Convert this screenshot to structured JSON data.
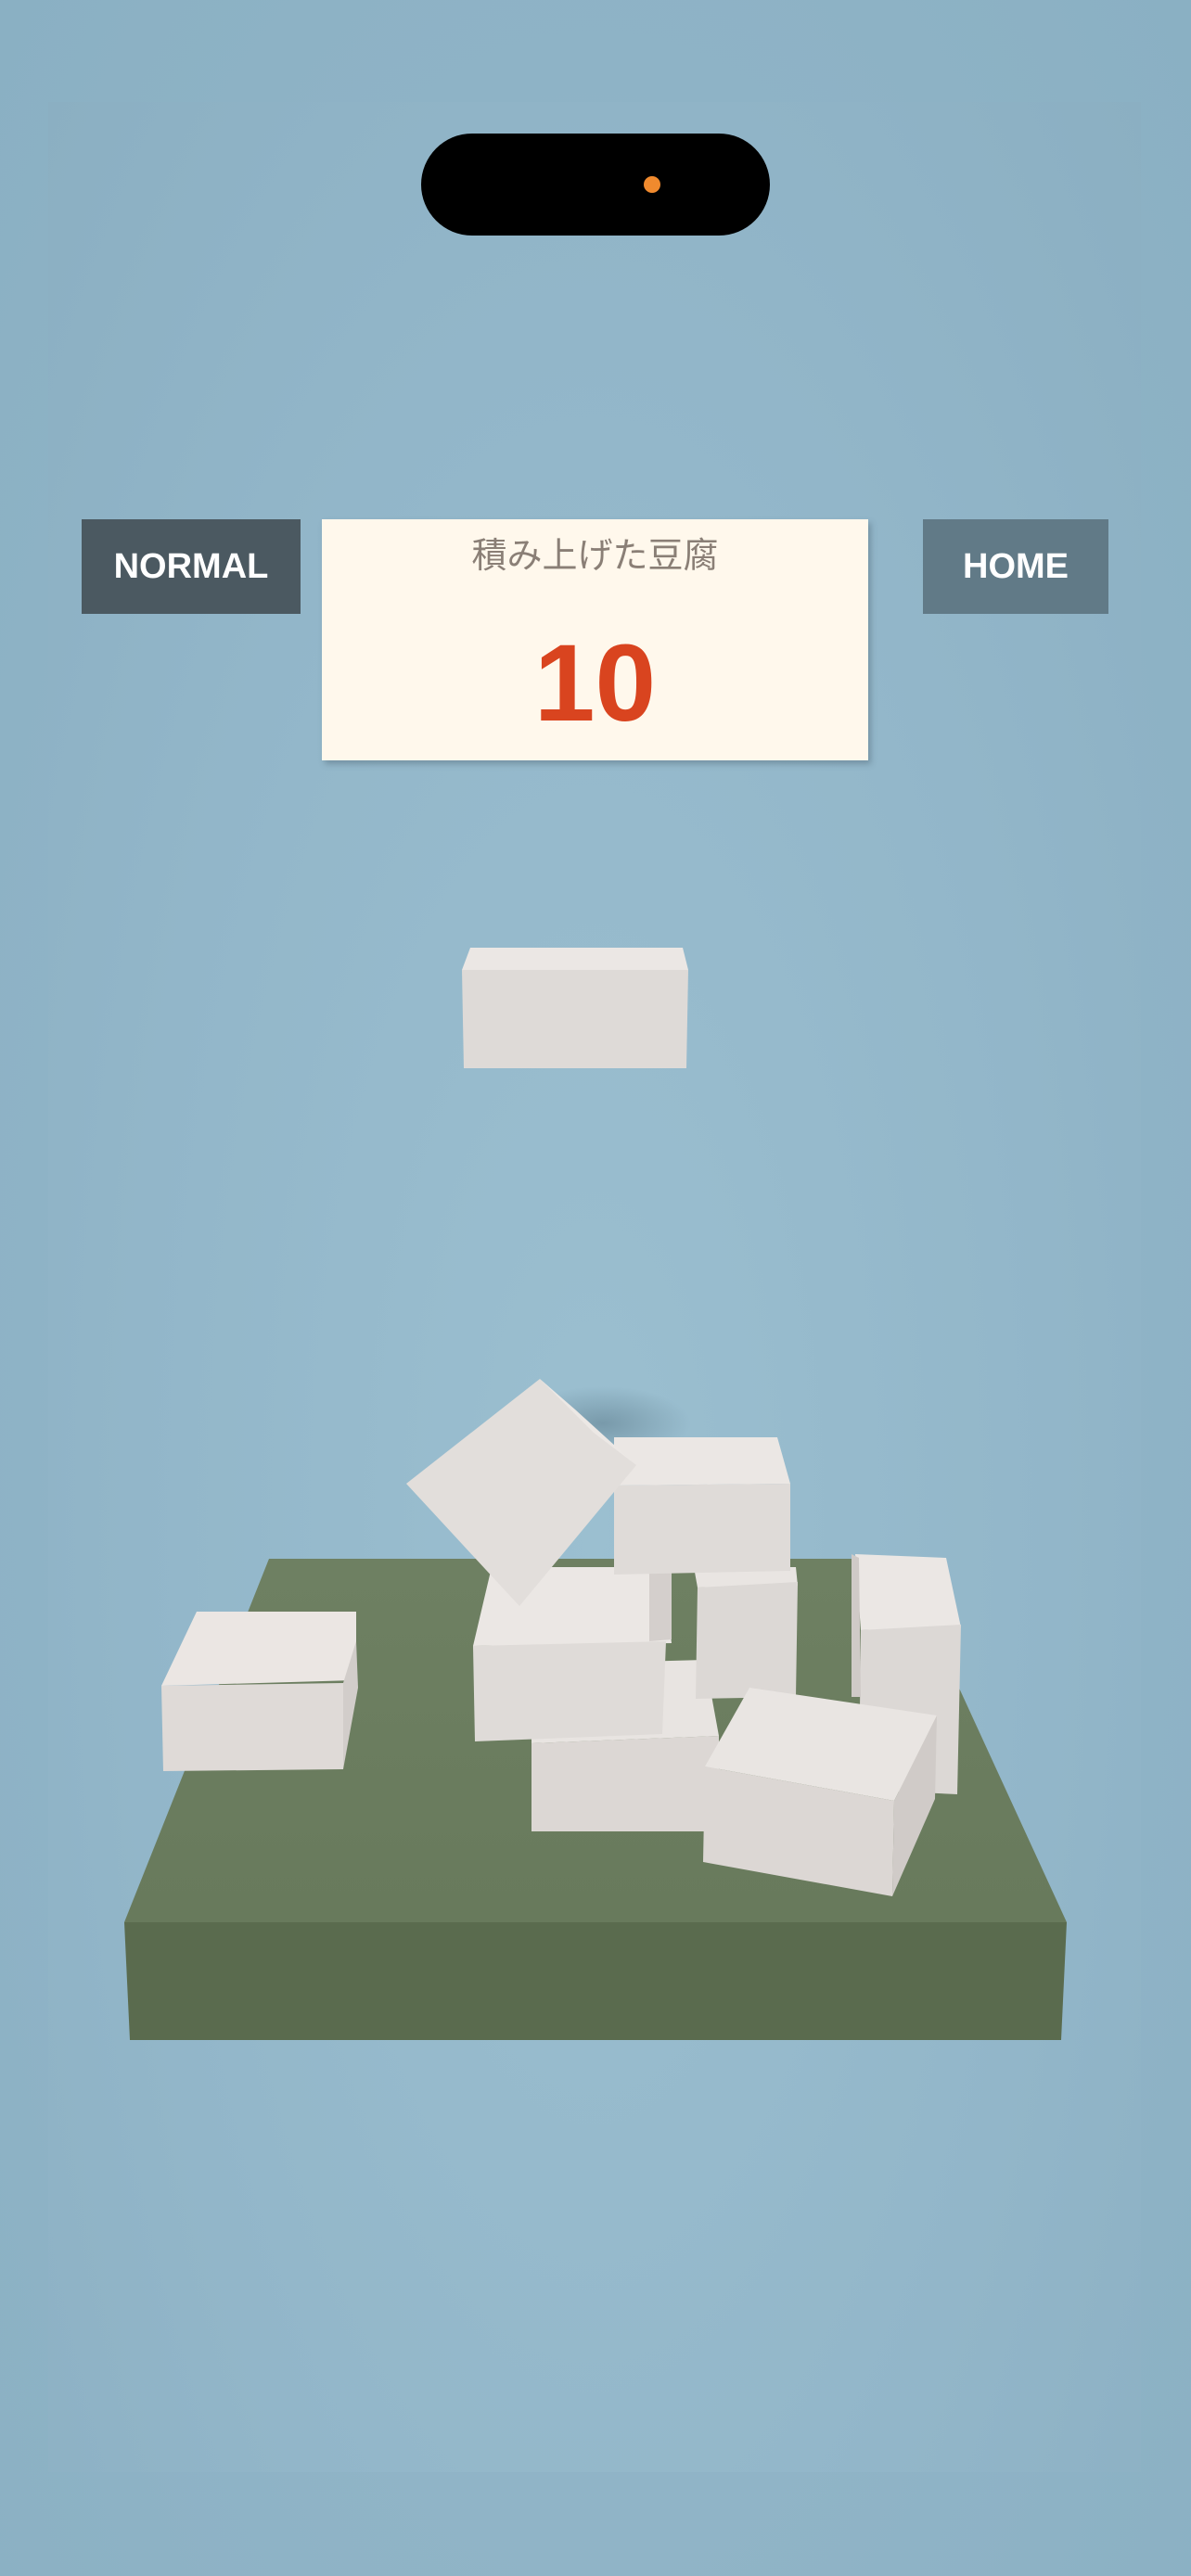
{
  "hud": {
    "mode_label": "NORMAL",
    "home_label": "HOME",
    "score_label": "積み上げた豆腐",
    "score_value": "10"
  },
  "colors": {
    "background": "#8fb3c6",
    "mode_button": "#4b5961",
    "home_button": "#617a87",
    "score_panel": "#fff8ec",
    "score_value": "#d9441f",
    "platform_top": "#6b7d5e",
    "platform_side": "#5a6b4e",
    "tofu": "#e3dedb",
    "camera_dot": "#f08a2e"
  }
}
